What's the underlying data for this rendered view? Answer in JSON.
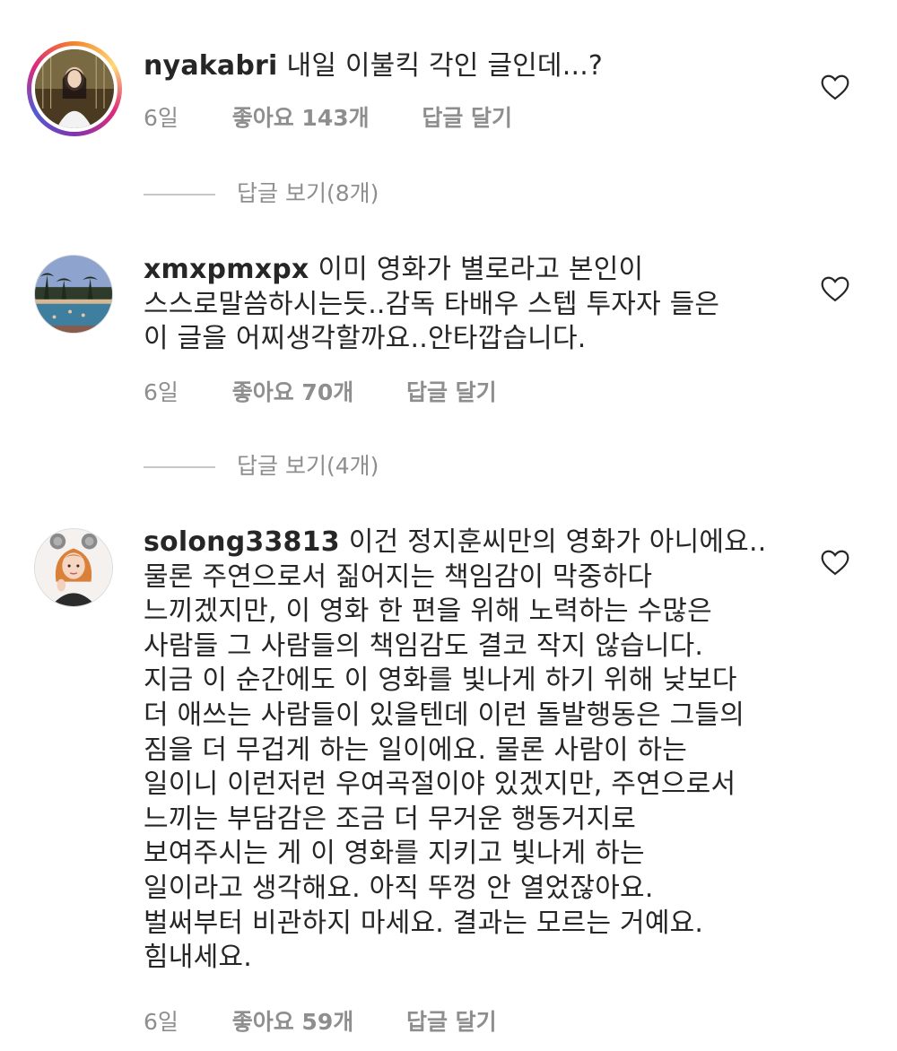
{
  "comments": [
    {
      "username": "nyakabri",
      "body_lines": [
        "내일 이불킥 각인 글인데...?"
      ],
      "time": "6일",
      "likes": "좋아요 143개",
      "reply": "답글 달기",
      "view_replies": "답글 보기(8개)",
      "avatar_icon": "user-avatar-icon",
      "heart_icon": "heart-outline-icon"
    },
    {
      "username": "xmxpmxpx",
      "body_lines": [
        "이미 영화가 별로라고 본인이",
        "스스로말씀하시는듯..감독 타배우 스텝 투자자 들은",
        "이 글을 어찌생각할까요..안타깝습니다."
      ],
      "time": "6일",
      "likes": "좋아요 70개",
      "reply": "답글 달기",
      "view_replies": "답글 보기(4개)",
      "avatar_icon": "user-avatar-icon",
      "heart_icon": "heart-outline-icon"
    },
    {
      "username": "solong33813",
      "body_lines": [
        "이건 정지훈씨만의 영화가 아니에요..",
        "물론 주연으로서 짊어지는 책임감이 막중하다",
        "느끼겠지만, 이 영화 한 편을 위해 노력하는 수많은",
        "사람들 그 사람들의 책임감도 결코 작지 않습니다.",
        "지금 이 순간에도 이 영화를 빛나게 하기 위해 낮보다",
        "더 애쓰는 사람들이 있을텐데 이런 돌발행동은 그들의",
        "짐을 더 무겁게 하는 일이에요. 물론 사람이 하는",
        "일이니 이런저런 우여곡절이야 있겠지만, 주연으로서",
        "느끼는 부담감은 조금 더 무거운 행동거지로",
        "보여주시는 게 이 영화를 지키고 빛나게 하는",
        "일이라고 생각해요. 아직 뚜껑 안 열었잖아요.",
        "벌써부터 비관하지 마세요. 결과는 모르는 거예요.",
        "힘내세요."
      ],
      "time": "6일",
      "likes": "좋아요 59개",
      "reply": "답글 달기",
      "avatar_icon": "user-avatar-icon",
      "heart_icon": "heart-outline-icon"
    }
  ],
  "colors": {
    "text": "#262626",
    "meta": "#8e8e8e",
    "divider": "#c7c7c7"
  }
}
